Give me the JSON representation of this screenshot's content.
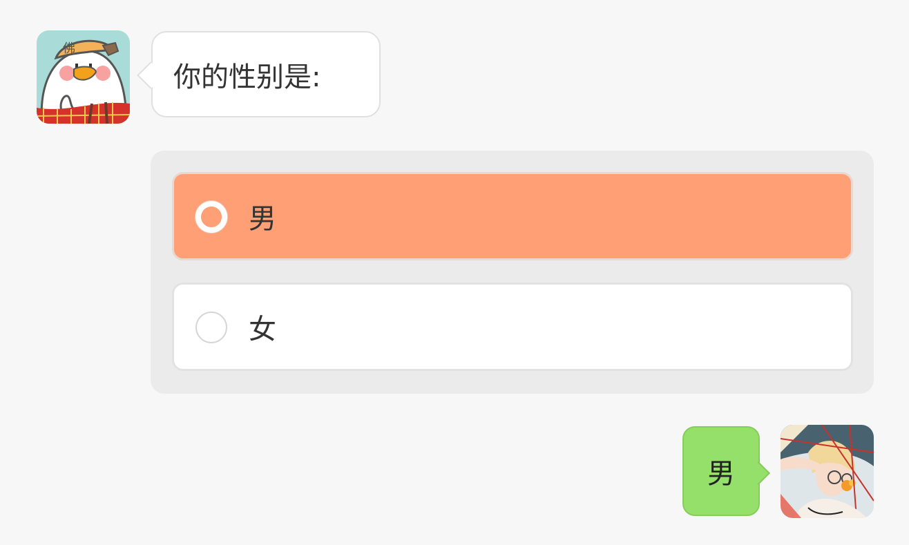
{
  "chat": {
    "question": "你的性别是:",
    "options": [
      {
        "label": "男",
        "selected": true
      },
      {
        "label": "女",
        "selected": false
      }
    ],
    "reply": "男"
  },
  "colors": {
    "page_background": "#f7f7f7",
    "selected_option": "#ff9f76",
    "reply_bubble": "#95e06a",
    "card_background": "#ebebeb"
  },
  "avatars": {
    "bot": {
      "name": "cartoon-duck-avatar",
      "cap_text": "佛"
    },
    "user": {
      "name": "illustrated-character-avatar"
    }
  }
}
